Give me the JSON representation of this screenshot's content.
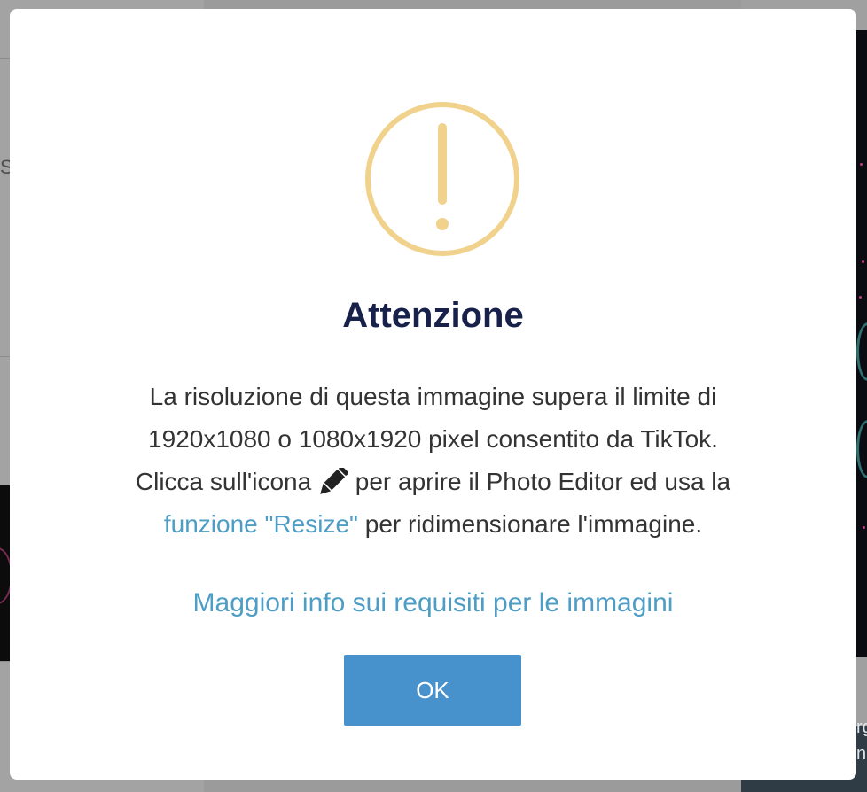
{
  "background": {
    "stray_left_char": "S",
    "stray_right_lines": [
      "rg",
      "ne"
    ]
  },
  "dialog": {
    "icon": "warning-circle-icon",
    "icon_color": "#f0d28c",
    "title": "Attenzione",
    "body": {
      "line1": "La risoluzione di questa immagine supera il limite di",
      "line2": "1920x1080 o 1080x1920 pixel consentito da TikTok.",
      "line3_before_icon": "Clicca sull'icona ",
      "line3_icon": "pencil-icon",
      "line3_after_icon": " per aprire il Photo Editor ed usa la",
      "line4_link": "funzione \"Resize\"",
      "line4_after_link": " per ridimensionare l'immagine."
    },
    "more_info_link": "Maggiori info sui requisiti per le immagini",
    "ok_button": "OK"
  },
  "colors": {
    "title": "#172149",
    "link": "#4d9dc4",
    "button": "#4792cc",
    "overlay": "#9b9b9b"
  }
}
